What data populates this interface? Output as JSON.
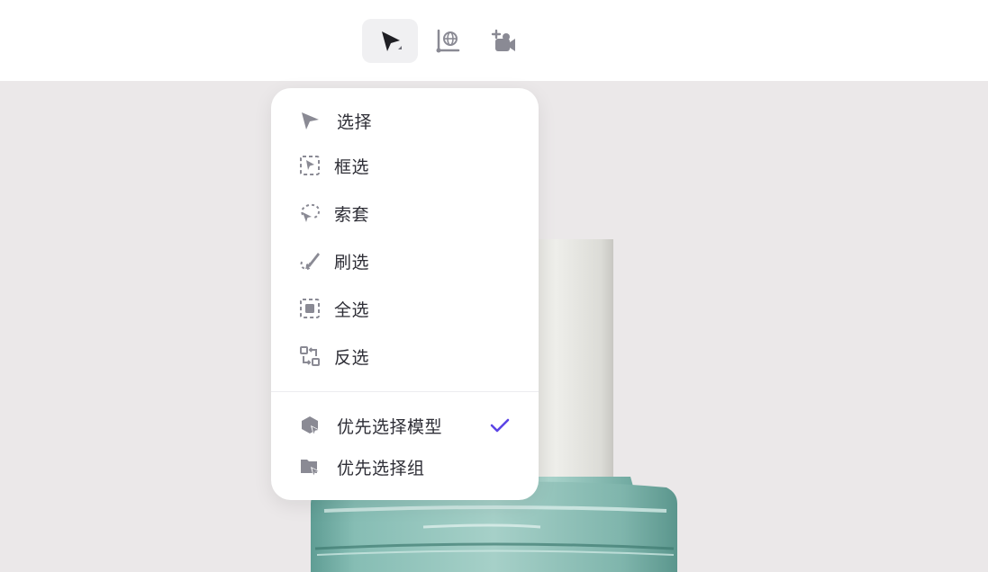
{
  "toolbar": {
    "tools": [
      {
        "name": "select-tool",
        "icon": "pointer-icon",
        "active": true
      },
      {
        "name": "world-axis-tool",
        "icon": "world-axis-icon",
        "active": false
      },
      {
        "name": "add-camera-tool",
        "icon": "add-camera-icon",
        "active": false
      }
    ]
  },
  "menu": {
    "items": [
      {
        "label": "选择",
        "icon": "pointer-icon"
      },
      {
        "label": "框选",
        "icon": "box-select-icon"
      },
      {
        "label": "索套",
        "icon": "lasso-icon"
      },
      {
        "label": "刷选",
        "icon": "brush-select-icon"
      },
      {
        "label": "全选",
        "icon": "select-all-icon"
      },
      {
        "label": "反选",
        "icon": "invert-select-icon"
      }
    ],
    "options": [
      {
        "label": "优先选择模型",
        "icon": "model-priority-icon",
        "checked": true
      },
      {
        "label": "优先选择组",
        "icon": "group-priority-icon",
        "checked": false
      }
    ]
  },
  "colors": {
    "accent": "#5b44e6",
    "icon": "#8a8a94",
    "canvas_bg": "#ebe8e9"
  }
}
